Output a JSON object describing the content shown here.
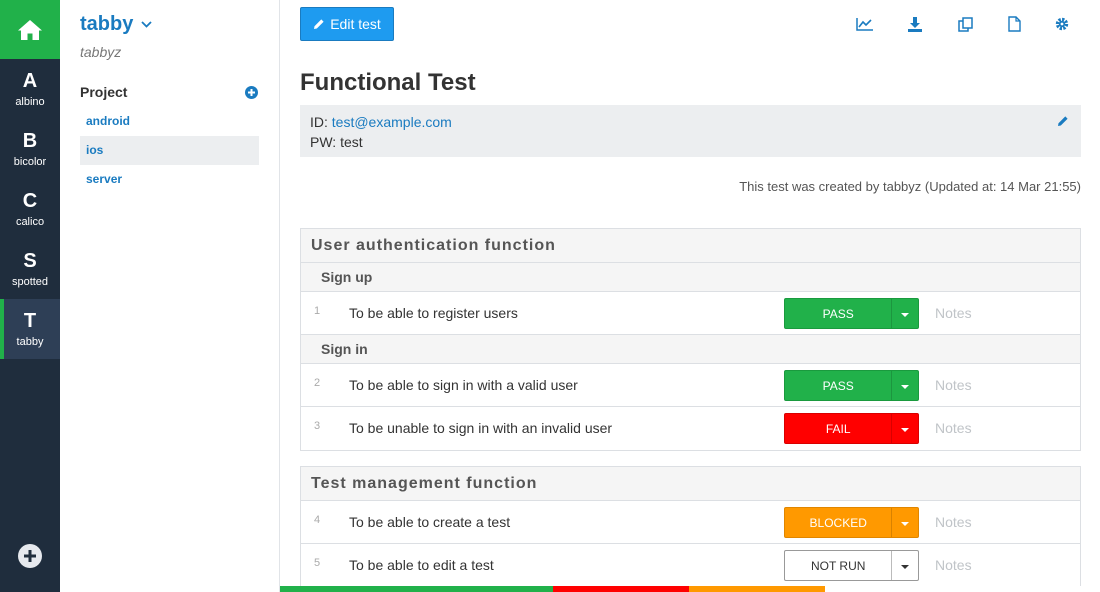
{
  "rail": {
    "items": [
      {
        "letter": "A",
        "name": "albino"
      },
      {
        "letter": "B",
        "name": "bicolor"
      },
      {
        "letter": "C",
        "name": "calico"
      },
      {
        "letter": "S",
        "name": "spotted"
      },
      {
        "letter": "T",
        "name": "tabby"
      }
    ],
    "active_index": 4
  },
  "sidebar": {
    "title": "tabby",
    "subtitle": "tabbyz",
    "section_label": "Project",
    "items": [
      {
        "label": "android"
      },
      {
        "label": "ios"
      },
      {
        "label": "server"
      }
    ],
    "active_index": 1
  },
  "toolbar": {
    "edit_label": "Edit test",
    "icons": [
      "chart-icon",
      "download-icon",
      "copy-icon",
      "file-icon",
      "gear-icon"
    ]
  },
  "main": {
    "title": "Functional Test",
    "info": {
      "id_label": "ID: ",
      "id_value": "test@example.com",
      "pw_line": "PW: test"
    },
    "meta": "This test was created by tabbyz (Updated at: 14 Mar 21:55)",
    "notes_placeholder": "Notes",
    "sections": [
      {
        "title": "User authentication function",
        "groups": [
          {
            "title": "Sign up",
            "rows": [
              {
                "num": "1",
                "text": "To be able to register users",
                "status": "PASS"
              }
            ]
          },
          {
            "title": "Sign in",
            "rows": [
              {
                "num": "2",
                "text": "To be able to sign in with a valid user",
                "status": "PASS"
              },
              {
                "num": "3",
                "text": "To be unable to sign in with an invalid user",
                "status": "FAIL"
              }
            ]
          }
        ]
      },
      {
        "title": "Test management function",
        "rows": [
          {
            "num": "4",
            "text": "To be able to create a test",
            "status": "BLOCKED"
          },
          {
            "num": "5",
            "text": "To be able to edit a test",
            "status": "NOT RUN"
          }
        ]
      }
    ]
  },
  "progress": {
    "segments": [
      {
        "status": "pass",
        "fraction": 0.333,
        "color": "#21b14a"
      },
      {
        "status": "fail",
        "fraction": 0.166,
        "color": "#ff0000"
      },
      {
        "status": "blocked",
        "fraction": 0.166,
        "color": "#ff9900"
      },
      {
        "status": "not-run",
        "fraction": 0.335,
        "color": "#ffffff"
      }
    ]
  },
  "colors": {
    "accent": "#1e9bf0",
    "link": "#1a7bc0",
    "rail_bg": "#1f2d3d",
    "home_bg": "#21b14a",
    "pass": "#21b14a",
    "fail": "#ff0000",
    "blocked": "#ff9900"
  }
}
